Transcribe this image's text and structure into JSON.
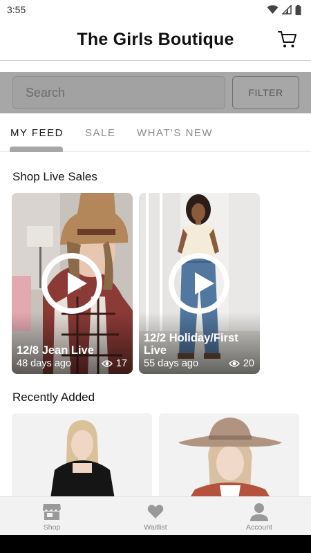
{
  "status": {
    "time": "3:55"
  },
  "header": {
    "title": "The Girls Boutique",
    "cart_icon": "cart-icon"
  },
  "search": {
    "placeholder": "Search",
    "filter_label": "FILTER"
  },
  "tabs": [
    {
      "label": "MY FEED",
      "active": true
    },
    {
      "label": "SALE",
      "active": false
    },
    {
      "label": "WHAT'S NEW",
      "active": false
    }
  ],
  "live_sales": {
    "title": "Shop Live Sales",
    "items": [
      {
        "title": "12/8 Jean Live",
        "age": "48 days ago",
        "views": "17"
      },
      {
        "title": "12/2 Holiday/First Live",
        "age": "55 days ago",
        "views": "20"
      }
    ]
  },
  "recently_added": {
    "title": "Recently Added"
  },
  "bottom_nav": [
    {
      "label": "Shop",
      "icon": "store-icon"
    },
    {
      "label": "Waitlist",
      "icon": "heart-icon"
    },
    {
      "label": "Account",
      "icon": "person-icon"
    }
  ],
  "colors": {
    "overlay_gray": "#a7a7a7",
    "nav_bg": "#f2f2f2",
    "text_dark": "#111111",
    "text_muted": "#8a8a8a"
  }
}
